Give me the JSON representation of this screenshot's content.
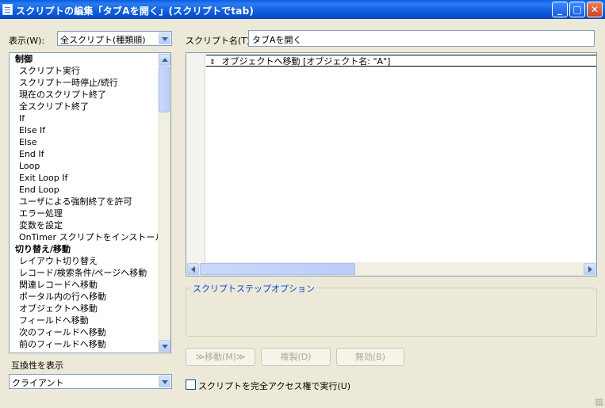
{
  "window": {
    "title": "スクリプトの編集「タブAを開く」(スクリプトでtab)",
    "minimize_glyph": "_",
    "maximize_glyph": "□",
    "close_glyph": "✕"
  },
  "view": {
    "label": "表示(W):",
    "selected": "全スクリプト(種類順)"
  },
  "script_name": {
    "label": "スクリプト名(T):",
    "value": "タブAを開く"
  },
  "steps_list": [
    {
      "label": "制御",
      "category": true
    },
    {
      "label": "スクリプト実行"
    },
    {
      "label": "スクリプト一時停止/続行"
    },
    {
      "label": "現在のスクリプト終了"
    },
    {
      "label": "全スクリプト終了"
    },
    {
      "label": "If"
    },
    {
      "label": "Else If"
    },
    {
      "label": "Else"
    },
    {
      "label": "End If"
    },
    {
      "label": "Loop"
    },
    {
      "label": "Exit Loop If"
    },
    {
      "label": "End Loop"
    },
    {
      "label": "ユーザによる強制終了を許可"
    },
    {
      "label": "エラー処理"
    },
    {
      "label": "変数を設定"
    },
    {
      "label": "OnTimer スクリプトをインストール"
    },
    {
      "label": "切り替え/移動",
      "category": true
    },
    {
      "label": "レイアウト切り替え"
    },
    {
      "label": "レコード/検索条件/ページへ移動"
    },
    {
      "label": "関連レコードへ移動"
    },
    {
      "label": "ポータル内の行へ移動"
    },
    {
      "label": "オブジェクトへ移動"
    },
    {
      "label": "フィールドへ移動"
    },
    {
      "label": "次のフィールドへ移動"
    },
    {
      "label": "前のフィールドへ移動"
    }
  ],
  "script_steps": [
    {
      "text": "オブジェクトへ移動 [オブジェクト名: \"A\"]"
    }
  ],
  "step_marker": "⇕",
  "options_group": {
    "title": "スクリプトステップオプション"
  },
  "buttons": {
    "move": "≫移動(M)≫",
    "duplicate": "複製(D)",
    "disable": "無効(B)"
  },
  "compatibility": {
    "label": "互換性を表示",
    "selected": "クライアント"
  },
  "full_access": {
    "label": "スクリプトを完全アクセス権で実行(U)",
    "checked": false
  }
}
